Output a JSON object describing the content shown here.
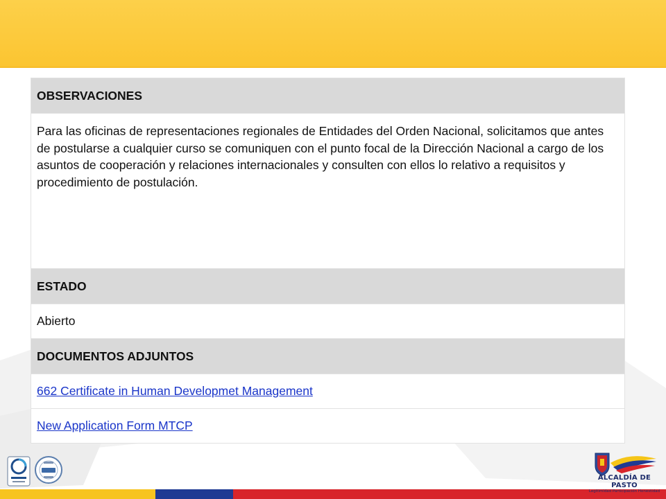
{
  "table": {
    "rows": [
      {
        "type": "header",
        "text": "OBSERVACIONES"
      },
      {
        "type": "text",
        "text": "Para las oficinas de representaciones regionales de Entidades del Orden Nacional, solicitamos que antes de postularse a cualquier curso se comuniquen con el punto focal de la Dirección Nacional a cargo de los asuntos de cooperación y relaciones internacionales y consulten con ellos lo relativo a requisitos y procedimiento de postulación."
      },
      {
        "type": "header",
        "text": "ESTADO"
      },
      {
        "type": "text",
        "text": "Abierto"
      },
      {
        "type": "header",
        "text": "DOCUMENTOS ADJUNTOS"
      },
      {
        "type": "link",
        "text": "662 Certificate in Human Developmet Management"
      },
      {
        "type": "link",
        "text": "New Application Form MTCP"
      }
    ]
  },
  "footer": {
    "logo_name": "ALCALDÍA DE PASTO",
    "logo_tagline": "Legitimidad Participación Honestidad",
    "cert_icons": [
      "iso-9001-certification-icon",
      "ntc-gp-1000-certification-icon"
    ],
    "stripe_colors": [
      "#f7c41f",
      "#1f3a93",
      "#d8252b"
    ]
  },
  "colors": {
    "top_band": "#fcca3c",
    "header_fill": "#d9d9d9",
    "link": "#1a35c9"
  }
}
